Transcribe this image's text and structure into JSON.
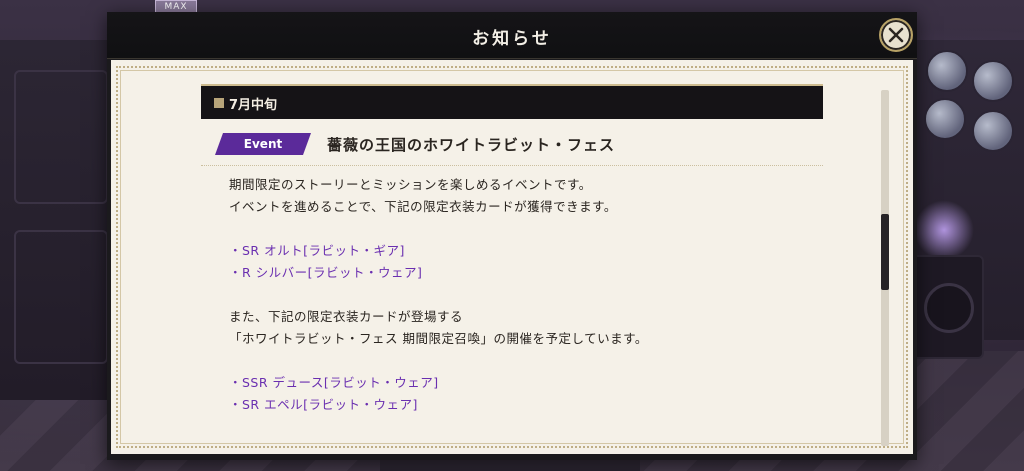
{
  "background": {
    "max_badge": "MAX"
  },
  "dialog": {
    "title": "お知らせ",
    "close_icon": "close-x-icon"
  },
  "notice": {
    "section_label": "7月中旬",
    "event_tag": "Event",
    "event_title": "薔薇の王国のホワイトラビット・フェス",
    "lines": [
      "期間限定のストーリーとミッションを楽しめるイベントです。",
      "イベントを進めることで、下記の限定衣装カードが獲得できます。"
    ],
    "cards_1": [
      "・SR オルト[ラビット・ギア]",
      "・R シルバー[ラビット・ウェア]"
    ],
    "lines_2": [
      "また、下記の限定衣装カードが登場する",
      "「ホワイトラビット・フェス 期間限定召喚」の開催を予定しています。"
    ],
    "cards_2": [
      "・SSR デュース[ラビット・ウェア]",
      "・SR エペル[ラビット・ウェア]"
    ]
  },
  "colors": {
    "accent_purple": "#5b2a9a",
    "card_text_purple": "#6a2fb0",
    "header_dark": "#151316",
    "paper": "#f5f1e8"
  }
}
